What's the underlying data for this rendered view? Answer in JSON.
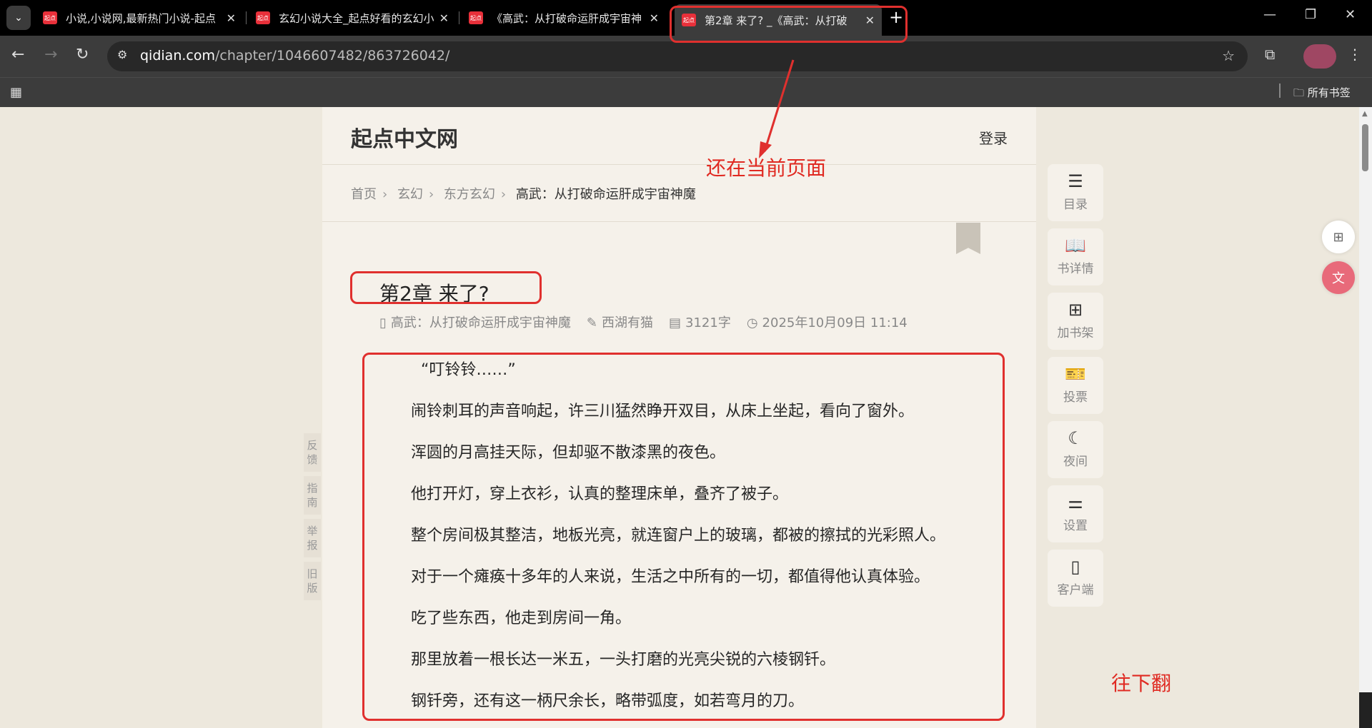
{
  "tabs": [
    {
      "title": "小说,小说网,最新热门小说-起点",
      "favicon": "起点"
    },
    {
      "title": "玄幻小说大全_起点好看的玄幻小",
      "favicon": "起点"
    },
    {
      "title": "《高武：从打破命运肝成宇宙神",
      "favicon": "起点"
    },
    {
      "title": "第2章 来了? _《高武：从打破",
      "favicon": "起点"
    }
  ],
  "url": {
    "host": "qidian.com",
    "path": "/chapter/1046607482/863726042/"
  },
  "bookmarks_bar": {
    "all_bookmarks": "所有书签"
  },
  "site": {
    "logo": "起点中文网",
    "login": "登录"
  },
  "breadcrumb": [
    "首页",
    "玄幻",
    "东方玄幻",
    "高武：从打破命运肝成宇宙神魔"
  ],
  "chapter": {
    "title": "第2章 来了?",
    "book": "高武：从打破命运肝成宇宙神魔",
    "author": "西湖有猫",
    "word_count": "3121字",
    "date": "2025年10月09日 11:14"
  },
  "paragraphs": [
    "“叮铃铃……”",
    "闹铃刺耳的声音响起，许三川猛然睁开双目，从床上坐起，看向了窗外。",
    "浑圆的月高挂天际，但却驱不散漆黑的夜色。",
    "他打开灯，穿上衣衫，认真的整理床单，叠齐了被子。",
    "整个房间极其整洁，地板光亮，就连窗户上的玻璃，都被的擦拭的光彩照人。",
    "对于一个瘫痪十多年的人来说，生活之中所有的一切，都值得他认真体验。",
    "吃了些东西，他走到房间一角。",
    "那里放着一根长达一米五，一头打磨的光亮尖锐的六棱钢钎。",
    "钢钎旁，还有这一柄尺余长，略带弧度，如若弯月的刀。"
  ],
  "left_links": [
    [
      "反",
      "馈"
    ],
    [
      "指",
      "南"
    ],
    [
      "举",
      "报"
    ],
    [
      "旧",
      "版"
    ]
  ],
  "side_menu": [
    "目录",
    "书详情",
    "加书架",
    "投票",
    "夜间",
    "设置",
    "客户端"
  ],
  "annotations": {
    "current_page": "还在当前页面",
    "scroll_down": "往下翻"
  },
  "colors": {
    "annotation": "#e0302e",
    "brand": "#e8303a",
    "page_bg": "#ede8dd"
  }
}
